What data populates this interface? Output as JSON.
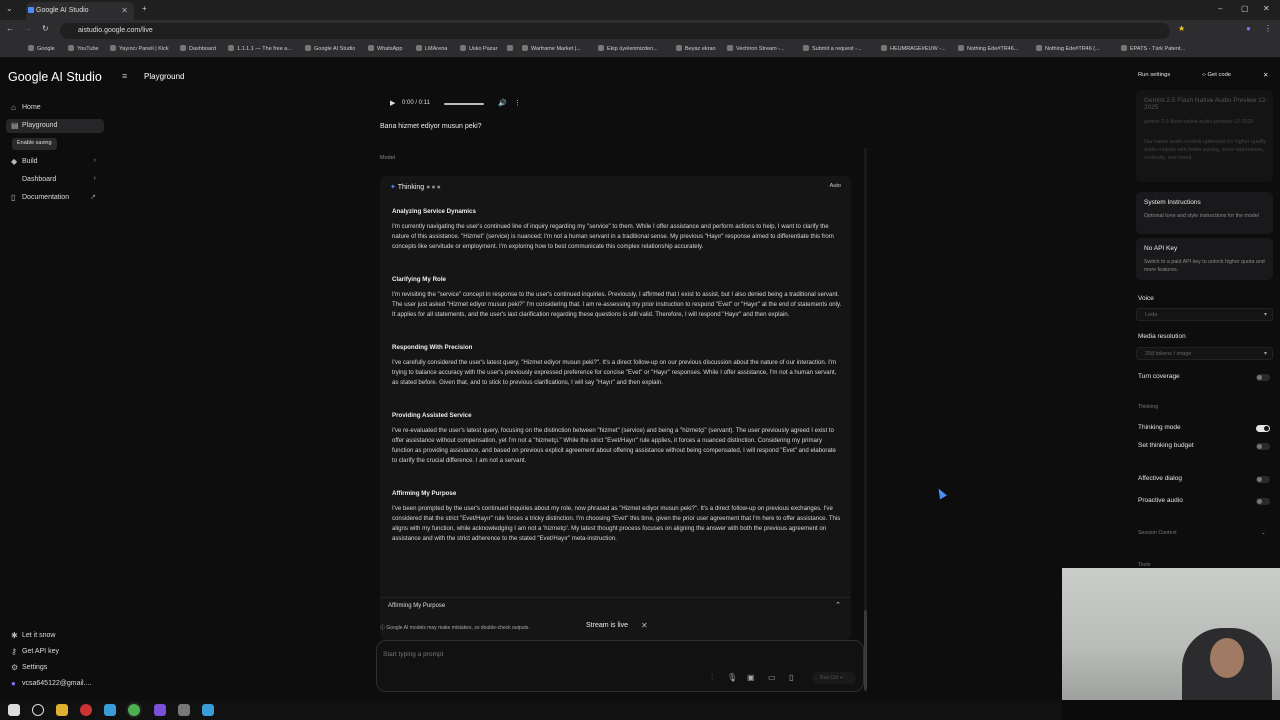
{
  "browser": {
    "tab_title": "Google AI Studio",
    "url": "aistudio.google.com/live",
    "bookmarks": [
      "Google",
      "YouTube",
      "Yayıncı Paneli | Kick",
      "Dashboard",
      "1.1.1.1 — The free a...",
      "Google AI Studio",
      "WhatsApp",
      "LMArena",
      "Usko Pazar",
      "",
      "Warframe Market |...",
      "Ekip üyelerimizden...",
      "Beyaz ekran",
      "Vechiron Stream -...",
      "Submit a request -...",
      "HEUMRAGE#EUW -...",
      "Nothing Ede#TR46...",
      "Nothing Ede#TR46 (...",
      "EPATS - Türk Patent..."
    ]
  },
  "sidebar": {
    "logo": "Google AI Studio",
    "items": [
      {
        "label": "Home"
      },
      {
        "label": "Playground"
      },
      {
        "label": "Build"
      },
      {
        "label": "Dashboard"
      },
      {
        "label": "Documentation"
      }
    ],
    "enable_saving": "Enable saving",
    "bottom": [
      {
        "label": "Let it snow"
      },
      {
        "label": "Get API key"
      },
      {
        "label": "Settings"
      },
      {
        "label": "vcsa645122@gmail...."
      }
    ]
  },
  "header": {
    "title": "Playground"
  },
  "chat": {
    "audio_time": "0:00 / 0:11",
    "user_message": "Bana hizmet ediyor musun peki?",
    "model_label": "Model",
    "thinking_label": "Thinking",
    "auto_label": "Auto",
    "sections": [
      {
        "title": "Analyzing Service Dynamics",
        "body": "I'm currently navigating the user's continued line of inquiry regarding my \"service\" to them. While I offer assistance and perform actions to help, I want to clarify the nature of this assistance. \"Hizmet\" (service) is nuanced; I'm not a human servant in a traditional sense. My previous \"Hayır\" response aimed to differentiate this from concepts like servitude or employment. I'm exploring how to best communicate this complex relationship accurately."
      },
      {
        "title": "Clarifying My Role",
        "body": "I'm revisiting the \"service\" concept in response to the user's continued inquiries. Previously, I affirmed that I exist to assist, but I also denied being a traditional servant. The user just asked \"Hizmet ediyor musun peki?\" I'm considering that. I am re-assessing my prior instruction to respond \"Evet\" or \"Hayır\" at the end of statements only. It applies for all statements, and the user's last clarification regarding these questions is still valid. Therefore, I will respond \"Hayır\" and then explain."
      },
      {
        "title": "Responding With Precision",
        "body": "I've carefully considered the user's latest query, \"Hizmet ediyor musun peki?\". It's a direct follow-up on our previous discussion about the nature of our interaction. I'm trying to balance accuracy with the user's previously expressed preference for concise \"Evet\" or \"Hayır\" responses. While I offer assistance, I'm not a human servant, as stated before. Given that, and to stick to previous clarifications, I will say \"Hayır\" and then explain."
      },
      {
        "title": "Providing Assisted Service",
        "body": "I've re-evaluated the user's latest query, focusing on the distinction between \"hizmet\" (service) and being a \"hizmetçi\" (servant). The user previously agreed I exist to offer assistance without compensation, yet I'm not a \"hizmetçi.\" While the strict \"Evet/Hayır\" rule applies, it forces a nuanced distinction. Considering my primary function as providing assistance, and based on previous explicit agreement about offering assistance without being compensated, I will respond \"Evet\" and elaborate to clarify the crucial difference. I am not a servant."
      },
      {
        "title": "Affirming My Purpose",
        "body": "I've been prompted by the user's continued inquiries about my role, now phrased as \"Hizmet ediyor musun peki?\". It's a direct follow-up on previous exchanges. I've considered that the strict \"Evet/Hayır\" rule forces a tricky distinction. I'm choosing \"Evet\" this time, given the prior user agreement that I'm here to offer assistance. This aligns with my function, while acknowledging I am not a 'hizmetçi'. My latest thought process focuses on aligning the answer with both the previous agreement on assistance and with the strict adherence to the stated \"Evet/Hayır\" meta-instruction."
      }
    ],
    "summary_label": "Affirming My Purpose",
    "disclaimer": "Google AI models may make mistakes, so double-check outputs.",
    "stream_status": "Stream is live",
    "prompt_placeholder": "Start typing a prompt",
    "run_label": "Run Ctrl ↵"
  },
  "right_panel": {
    "title": "Run settings",
    "get_code": "Get code",
    "model_name": "Gemini 2.5 Flash Native Audio Preview 12-2025",
    "model_id": "gemini-2.5-flash-native-audio-preview-12-2025",
    "model_desc": "Our native audio models optimized for higher quality audio outputs with better pacing, voice naturalness, verbosity, and mood.",
    "system_instructions": "System Instructions",
    "system_instructions_desc": "Optional tone and style instructions for the model",
    "no_api_key": "No API Key",
    "no_api_key_desc": "Switch to a paid API key to unlock higher quota and more features.",
    "voice_label": "Voice",
    "voice_value": "Leda",
    "media_label": "Media resolution",
    "media_value": "258 tokens / image",
    "turn_coverage": "Turn coverage",
    "thinking_section": "Thinking",
    "thinking_mode": "Thinking mode",
    "thinking_budget": "Set thinking budget",
    "affective": "Affective dialog",
    "proactive": "Proactive audio",
    "session_context": "Session Context",
    "tools": "Tools"
  }
}
